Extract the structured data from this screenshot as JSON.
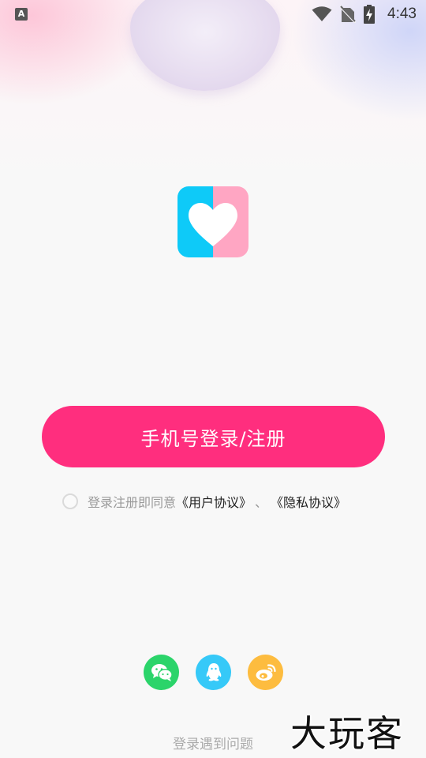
{
  "status_bar": {
    "app_icon_letter": "A",
    "time": "4:43",
    "icons": [
      "wifi-icon",
      "no-sim-icon",
      "battery-charging-icon"
    ]
  },
  "logo": {
    "name": "heart-logo-icon",
    "colors": {
      "left": "#0ecaf8",
      "right": "#ffa6c3"
    }
  },
  "login": {
    "button_label": "手机号登录/注册",
    "button_color": "#ff2e7e"
  },
  "agreement": {
    "prefix": "登录注册即同意",
    "user_agreement": "《用户协议》",
    "separator": "、",
    "privacy_policy": "《隐私协议》",
    "checked": false
  },
  "social_login": [
    {
      "name": "wechat-icon",
      "color": "#2bd46a"
    },
    {
      "name": "qq-icon",
      "color": "#36c9f8"
    },
    {
      "name": "weibo-icon",
      "color": "#fdbc3f"
    }
  ],
  "footer": {
    "problem_link": "登录遇到问题"
  },
  "watermark": {
    "text": "大玩客"
  }
}
